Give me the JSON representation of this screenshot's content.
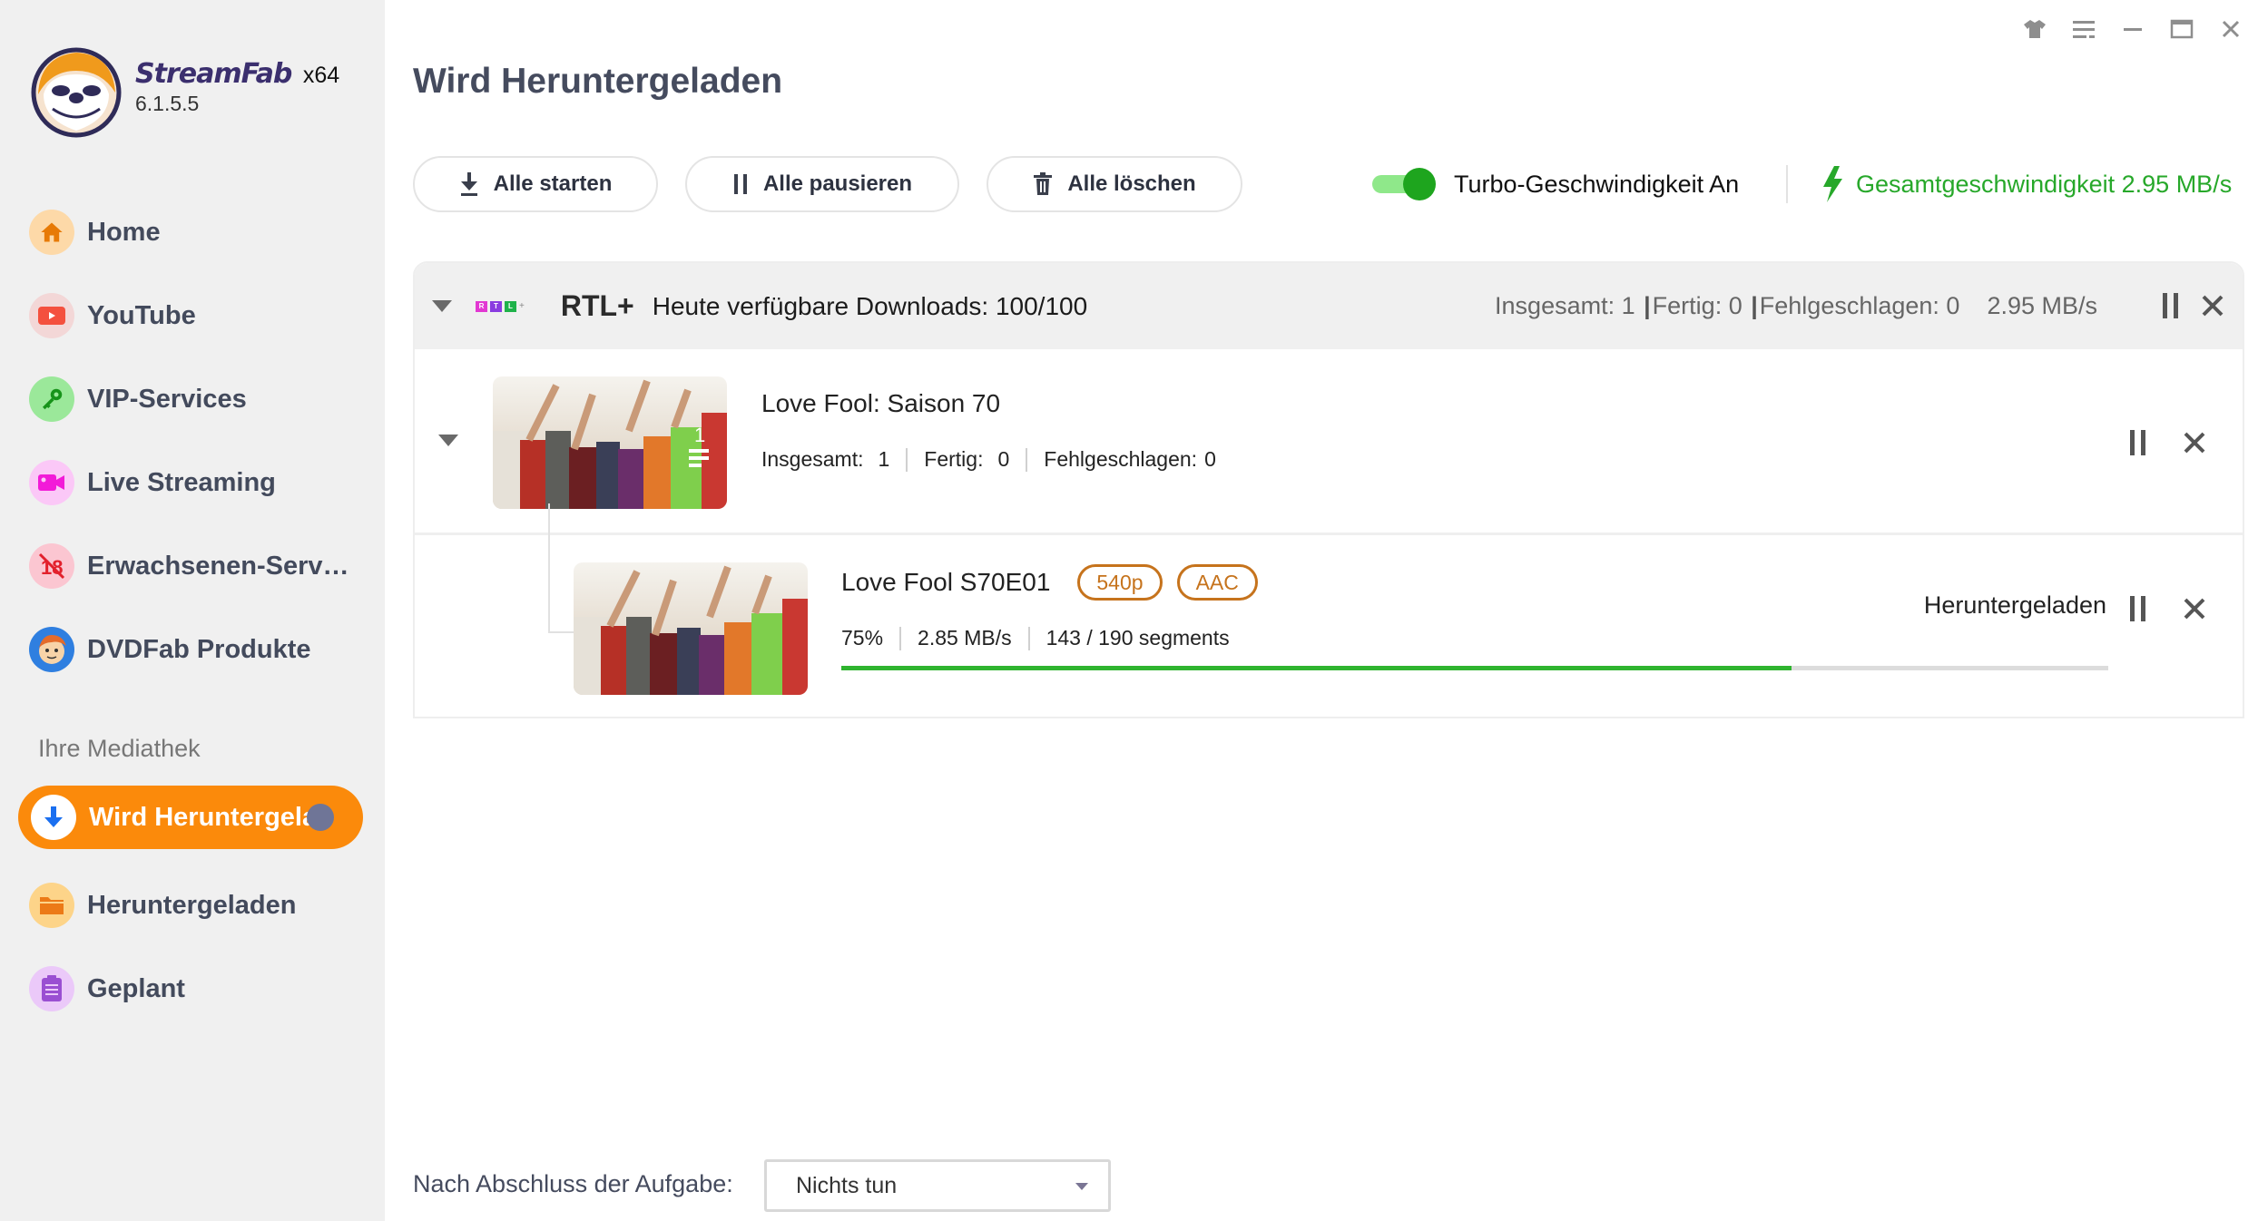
{
  "app": {
    "brand_name": "StreamFab",
    "arch": "x64",
    "version": "6.1.5.5"
  },
  "window_controls": [
    {
      "name": "skin-icon"
    },
    {
      "name": "menu-icon"
    },
    {
      "name": "minimize-icon"
    },
    {
      "name": "maximize-icon"
    },
    {
      "name": "close-icon"
    }
  ],
  "sidebar": {
    "items": [
      {
        "label": "Home",
        "icon": "home-icon",
        "icon_bg": "#fdd9a8",
        "icon_color": "#e77a06"
      },
      {
        "label": "YouTube",
        "icon": "youtube-icon",
        "icon_bg": "#f3d7d7",
        "icon_color": "#f4503e"
      },
      {
        "label": "VIP-Services",
        "icon": "key-icon",
        "icon_bg": "#9be89a",
        "icon_color": "#17931a"
      },
      {
        "label": "Live Streaming",
        "icon": "video-camera-icon",
        "icon_bg": "#fbc8f7",
        "icon_color": "#f21ad8"
      },
      {
        "label": "Erwachsenen-Serv…",
        "icon": "adult-18-icon",
        "icon_bg": "#fbc6d1",
        "icon_color": "#e2202c"
      },
      {
        "label": "DVDFab Produkte",
        "icon": "dvdfab-icon",
        "icon_bg": "#2f7fe0",
        "icon_color": "#f4a640"
      }
    ],
    "library_section_label": "Ihre Mediathek",
    "library": [
      {
        "label": "Wird Heruntergeladen",
        "icon": "download-arrow-icon",
        "active": true
      },
      {
        "label": "Heruntergeladen",
        "icon": "folder-icon",
        "icon_bg": "#fdd489",
        "icon_color": "#ec7a17"
      },
      {
        "label": "Geplant",
        "icon": "schedule-list-icon",
        "icon_bg": "#ebc9f9",
        "icon_color": "#9a4fd2"
      }
    ]
  },
  "main": {
    "title": "Wird Heruntergeladen",
    "toolbar": {
      "start_all": "Alle starten",
      "pause_all": "Alle pausieren",
      "delete_all": "Alle löschen",
      "turbo_label": "Turbo-Geschwindigkeit An",
      "turbo_on": true,
      "total_speed": "Gesamtgeschwindigkeit 2.95 MB/s"
    },
    "group": {
      "service": "RTL+",
      "available": "Heute verfügbare Downloads: 100/100",
      "total": "Insgesamt: 1",
      "done": "Fertig: 0",
      "failed": "Fehlgeschlagen: 0",
      "speed": "2.95 MB/s",
      "logo_letters": [
        "R",
        "T",
        "L"
      ],
      "logo_colors": [
        "#e238d2",
        "#8a3de0",
        "#1fb24a"
      ],
      "season": {
        "title": "Love Fool: Saison 70",
        "thumb_count": "1",
        "total_label": "Insgesamt:",
        "total_value": "1",
        "done_label": "Fertig:",
        "done_value": "0",
        "failed_label": "Fehlgeschlagen:",
        "failed_value": "0",
        "episode": {
          "title": "Love Fool S70E01",
          "quality_tag": "540p",
          "audio_tag": "AAC",
          "percent": "75%",
          "speed": "2.85 MB/s",
          "segments": "143 / 190 segments",
          "progress": 0.75,
          "status": "Heruntergeladen"
        }
      }
    },
    "footer": {
      "after_task_label": "Nach Abschluss der Aufgabe:",
      "after_task_value": "Nichts tun"
    }
  },
  "colors": {
    "accent": "#fb8a0b",
    "success": "#27a82a",
    "tag": "#c6731c"
  }
}
